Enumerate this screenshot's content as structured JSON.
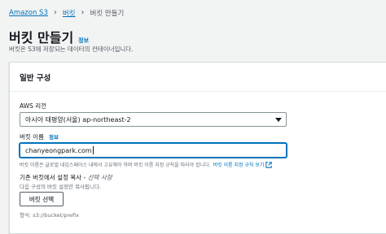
{
  "breadcrumb": {
    "root": "Amazon S3",
    "parent": "버킷",
    "current": "버킷 만들기"
  },
  "header": {
    "title": "버킷 만들기",
    "info_link": "정보",
    "description": "버킷은 S3에 저장되는 데이터의 컨테이너입니다."
  },
  "general_config": {
    "heading": "일반 구성",
    "region": {
      "label": "AWS 리전",
      "selected": "아시아 태평양(서울) ap-northeast-2"
    },
    "bucket_name": {
      "label": "버킷 이름",
      "info_link": "정보",
      "value": "chanyeongpark.com",
      "hint": "버킷 이름은 글로벌 네임스페이스 내에서 고유해야 하며 버킷 이름 지정 규칙을 따라야 합니다.",
      "rules_link": "버킷 이름 지정 규칙 보기"
    },
    "copy_settings": {
      "label": "기존 버킷에서 설정 복사 - ",
      "optional": "선택 사항",
      "description": "다음 구성의 버킷 설정만 복사됩니다.",
      "button": "버킷 선택",
      "format": "형식: s3://bucket/prefix"
    }
  },
  "colors": {
    "link": "#0073bb",
    "background": "#f2f3f3",
    "panel": "#ffffff"
  }
}
